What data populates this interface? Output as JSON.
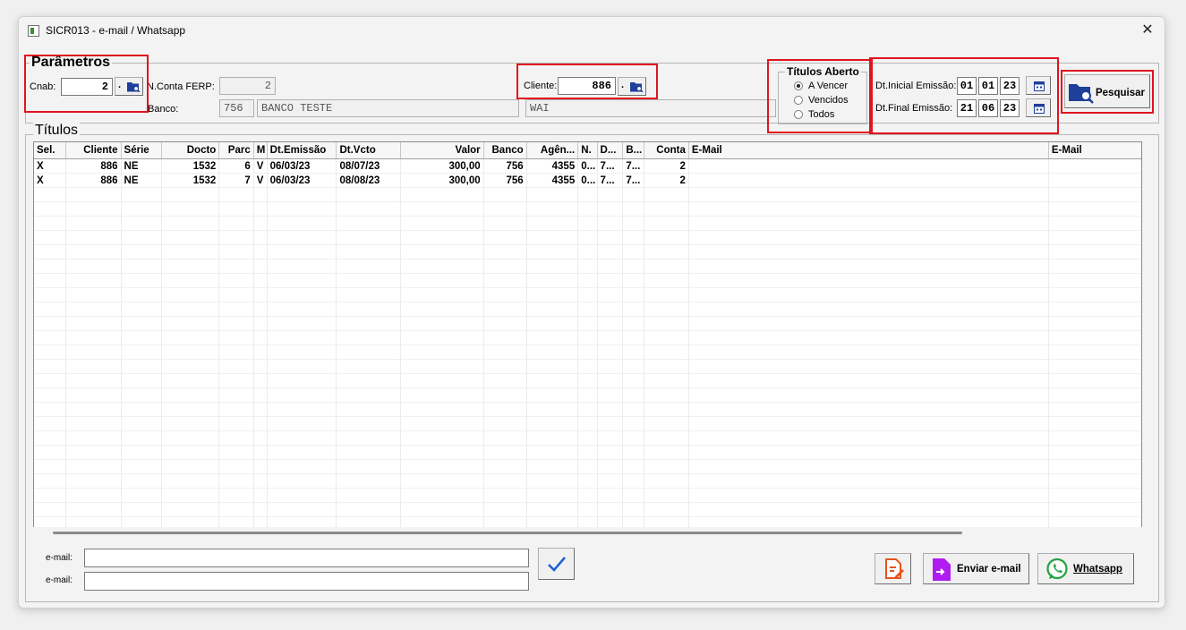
{
  "window": {
    "title": "SICR013 - e-mail / Whatsapp"
  },
  "params": {
    "legend": "Parâmetros",
    "cnab_label": "Cnab:",
    "cnab_value": "2",
    "conta_label": "N.Conta FERP:",
    "conta_value": "2",
    "banco_label": "Banco:",
    "banco_code": "756",
    "banco_name": "BANCO TESTE",
    "cliente_label": "Cliente:",
    "cliente_value": "886",
    "cliente_name": "WAI",
    "lookup_dot": "."
  },
  "titulos_aberto": {
    "legend": "Títulos Aberto",
    "options": [
      "A Vencer",
      "Vencidos",
      "Todos"
    ],
    "selected": "A Vencer"
  },
  "dates": {
    "inicial_label": "Dt.Inicial Emissão:",
    "inicial": [
      "01",
      "01",
      "23"
    ],
    "final_label": "Dt.Final Emissão:",
    "final": [
      "21",
      "06",
      "23"
    ]
  },
  "search_button": {
    "label": "Pesquisar"
  },
  "grid": {
    "legend": "Títulos",
    "columns": [
      "Sel.",
      "Cliente",
      "Série",
      "Docto",
      "Parc",
      "M",
      "Dt.Emissão",
      "Dt.Vcto",
      "Valor",
      "Banco",
      "Agên...",
      "N.",
      "D...",
      "B...",
      "Conta",
      "E-Mail",
      "E-Mail"
    ],
    "rows": [
      [
        "X",
        "886",
        "NE",
        "1532",
        "6",
        "V",
        "06/03/23",
        "08/07/23",
        "300,00",
        "756",
        "4355",
        "0...",
        "7...",
        "7...",
        "2",
        "",
        ""
      ],
      [
        "X",
        "886",
        "NE",
        "1532",
        "7",
        "V",
        "06/03/23",
        "08/08/23",
        "300,00",
        "756",
        "4355",
        "0...",
        "7...",
        "7...",
        "2",
        "",
        ""
      ]
    ]
  },
  "email": {
    "label1": "e-mail:",
    "label2": "e-mail:",
    "value1": "",
    "value2": ""
  },
  "actions": {
    "enviar_email": "Enviar e-mail",
    "whatsapp": "Whatsapp"
  },
  "colors": {
    "red_highlight": "#e0141e",
    "check_blue": "#1f5fd1",
    "whatsapp_green": "#25a244",
    "email_purple": "#b01df0",
    "edit_orange": "#e8541c",
    "folder_blue": "#1e3f9a"
  }
}
